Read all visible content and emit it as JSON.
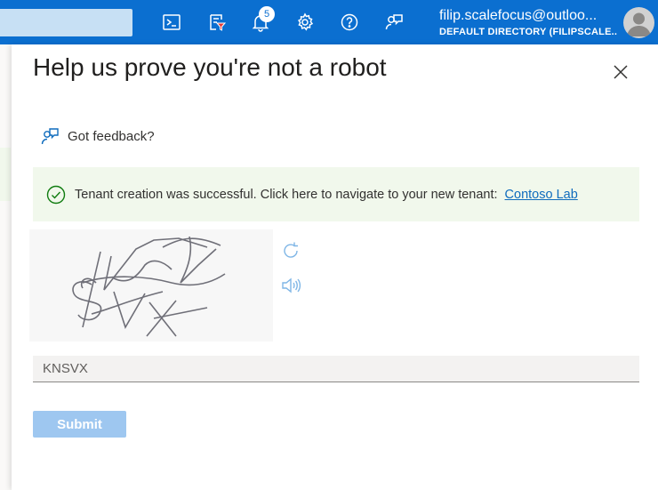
{
  "topbar": {
    "notification_count": "5",
    "icons": [
      "cloud-shell-icon",
      "directory-filter-icon",
      "notifications-icon",
      "settings-icon",
      "help-icon",
      "feedback-icon"
    ],
    "account_name": "filip.scalefocus@outloo...",
    "account_directory": "DEFAULT DIRECTORY (FILIPSCALE..."
  },
  "dialog": {
    "title": "Help us prove you're not a robot",
    "feedback_label": "Got feedback?",
    "banner": {
      "text": "Tenant creation was successful. Click here to navigate to your new tenant:",
      "link": "Contoso Lab"
    },
    "captcha": {
      "characters": "KNSVX"
    },
    "input_value": "KNSVX",
    "submit_label": "Submit"
  },
  "colors": {
    "topbar": "#0b6fd0",
    "banner_bg": "#f1f8ec",
    "success_green": "#107c10",
    "link": "#0f6cbd",
    "submit_disabled": "#9ec7f0"
  }
}
